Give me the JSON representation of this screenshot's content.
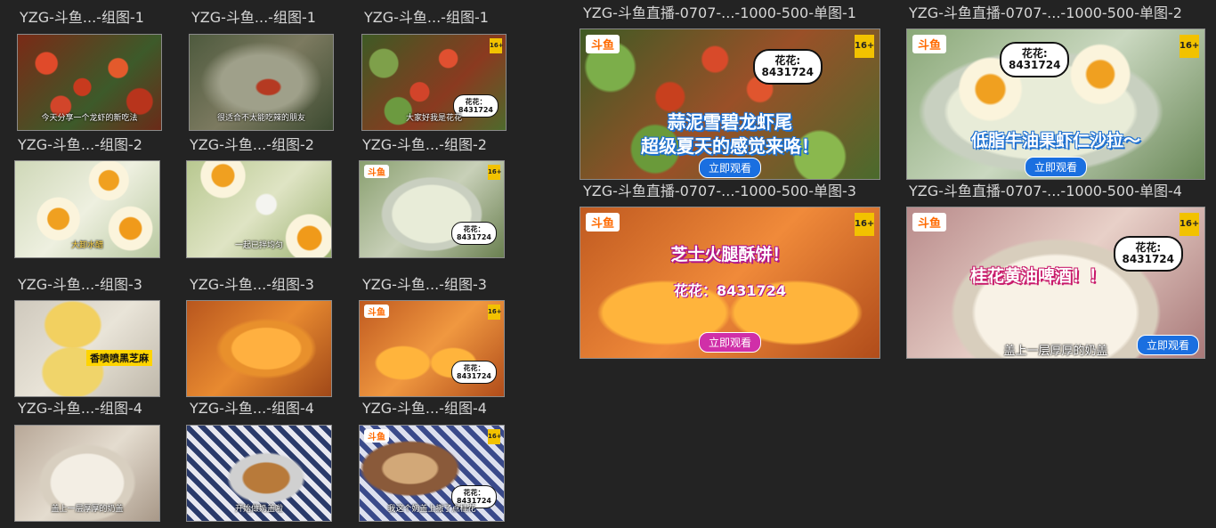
{
  "grid": {
    "rows": [
      {
        "captions": [
          "YZG-斗鱼...-组图-1",
          "YZG-斗鱼...-组图-1",
          "YZG-斗鱼...-组图-1"
        ],
        "thumbs": [
          {
            "subtitle": "今天分享一个龙虾的新吃法"
          },
          {
            "subtitle": "很适合不太能吃辣的朋友"
          },
          {
            "subtitle": "大家好我是花花",
            "bubble": "花花：\n8431724"
          }
        ]
      },
      {
        "captions": [
          "YZG-斗鱼...-组图-2",
          "YZG-斗鱼...-组图-2",
          "YZG-斗鱼...-组图-2"
        ],
        "thumbs": [
          {
            "subtitle": "大卸水醋"
          },
          {
            "subtitle": "一起已拌均匀"
          },
          {
            "logo": "斗鱼",
            "age": "16+",
            "bubble": "花花：\n8431724"
          }
        ]
      },
      {
        "captions": [
          "YZG-斗鱼...-组图-3",
          "YZG-斗鱼...-组图-3",
          "YZG-斗鱼...-组图-3"
        ],
        "thumbs": [
          {
            "brand": "香喷喷黑芝麻"
          },
          {},
          {
            "logo": "斗鱼",
            "age": "16+",
            "bubble": "花花：\n8431724"
          }
        ]
      },
      {
        "captions": [
          "YZG-斗鱼...-组图-4",
          "YZG-斗鱼...-组图-4",
          "YZG-斗鱼...-组图-4"
        ],
        "thumbs": [
          {
            "subtitle": "盖上一层厚厚的奶盖"
          },
          {
            "subtitle": "开始做奶盖啦"
          },
          {
            "logo": "斗鱼",
            "age": "16+",
            "subtitle": "我这个奶盖上撒了点桂花",
            "bubble": "花花：\n8431724"
          }
        ]
      }
    ]
  },
  "banners": [
    {
      "caption": "YZG-斗鱼直播-0707-...-1000-500-单图-1",
      "logo": "斗鱼",
      "age": "16+",
      "bubble": "花花:\n8431724",
      "headline1": "蒜泥雪碧龙虾尾",
      "headline2": "超级夏天的感觉来咯！",
      "cta": "立即观看"
    },
    {
      "caption": "YZG-斗鱼直播-0707-...-1000-500-单图-2",
      "logo": "斗鱼",
      "age": "16+",
      "bubble": "花花:\n8431724",
      "headline1": "低脂牛油果虾仁沙拉～",
      "cta": "立即观看"
    },
    {
      "caption": "YZG-斗鱼直播-0707-...-1000-500-单图-3",
      "logo": "斗鱼",
      "age": "16+",
      "headline1": "芝士火腿酥饼！",
      "code": "花花：8431724",
      "cta": "立即观看"
    },
    {
      "caption": "YZG-斗鱼直播-0707-...-1000-500-单图-4",
      "logo": "斗鱼",
      "age": "16+",
      "bubble": "花花:\n8431724",
      "headline1": "桂花黄油啤酒！！",
      "subtitle": "盖上一层厚厚的奶盖",
      "cta": "立即观看"
    }
  ],
  "colors": {
    "background": "#232323",
    "cta_blue": "#1a6fe0",
    "cta_magenta": "#d02fa8",
    "brand_orange": "#ff6a00",
    "age_badge": "#f2c200"
  }
}
